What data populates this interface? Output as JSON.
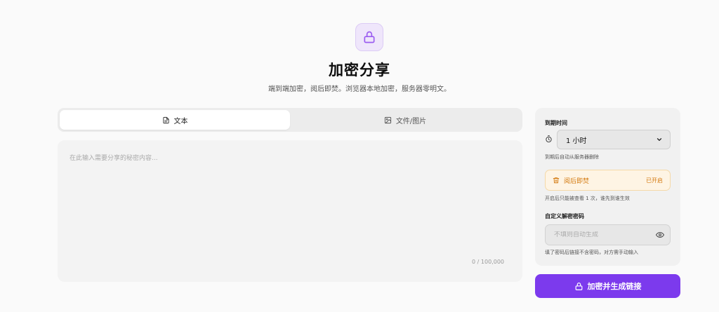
{
  "header": {
    "title": "加密分享",
    "subtitle": "端到端加密，阅后即焚。浏览器本地加密，服务器零明文。",
    "logo_icon": "lock-icon"
  },
  "tabs": [
    {
      "label": "文本",
      "icon": "document-icon",
      "active": true
    },
    {
      "label": "文件/图片",
      "icon": "image-icon",
      "active": false
    }
  ],
  "editor": {
    "placeholder": "在此输入需要分享的秘密内容...",
    "value": "",
    "counter": "0 / 100,000"
  },
  "settings": {
    "expiry_label": "到期时间",
    "expiry_value": "1 小时",
    "expiry_hint": "到期后自动从服务器删除",
    "burn_label": "阅后即焚",
    "burn_status": "已开启",
    "burn_hint": "开启后只能被查看 1 次，谁先到谁生效",
    "password_label": "自定义解密密码",
    "password_placeholder": "不填则自动生成",
    "password_hint": "填了密码后链接不含密码，对方需手动输入"
  },
  "submit": {
    "label": "加密并生成链接"
  },
  "colors": {
    "accent": "#7c3aed",
    "burn_text": "#d47a10",
    "burn_bg": "#fef4e4"
  }
}
